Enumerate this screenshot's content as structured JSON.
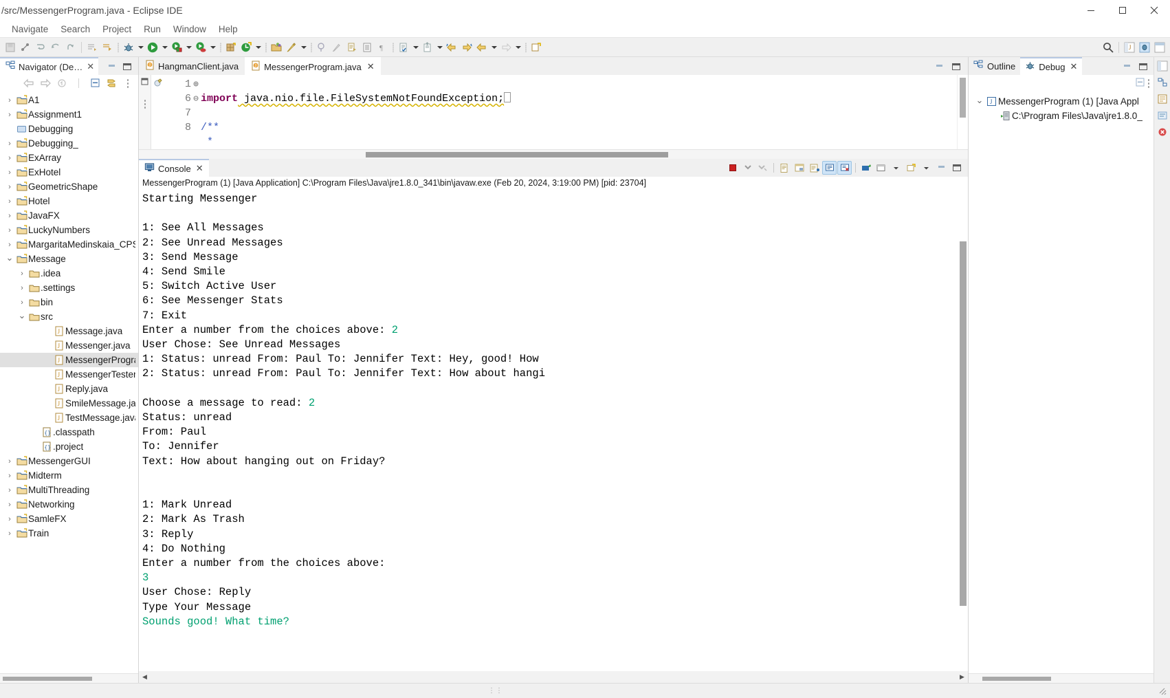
{
  "window": {
    "title": "/src/MessengerProgram.java - Eclipse IDE",
    "minimize_label": "─",
    "maximize_label": "❐",
    "close_label": "✕"
  },
  "menubar": {
    "items": [
      "Navigate",
      "Search",
      "Project",
      "Run",
      "Window",
      "Help"
    ]
  },
  "navigator": {
    "tab_label": "Navigator (De…",
    "tab_close": "✕",
    "toolbar": [
      "back-icon",
      "forward-icon",
      "up-icon",
      "collapse-all-icon",
      "link-with-editor-icon",
      "view-menu-icon"
    ],
    "items": [
      {
        "label": "A1",
        "indent": 0,
        "twisty": "›",
        "icon": "project-folder"
      },
      {
        "label": "Assignment1",
        "indent": 0,
        "twisty": "›",
        "icon": "project-folder"
      },
      {
        "label": "Debugging",
        "indent": 0,
        "twisty": "",
        "icon": "closed-project"
      },
      {
        "label": "Debugging_",
        "indent": 0,
        "twisty": "›",
        "icon": "project-folder"
      },
      {
        "label": "ExArray",
        "indent": 0,
        "twisty": "›",
        "icon": "project-folder"
      },
      {
        "label": "ExHotel",
        "indent": 0,
        "twisty": "›",
        "icon": "project-folder"
      },
      {
        "label": "GeometricShape",
        "indent": 0,
        "twisty": "›",
        "icon": "project-folder"
      },
      {
        "label": "Hotel",
        "indent": 0,
        "twisty": "›",
        "icon": "project-folder"
      },
      {
        "label": "JavaFX",
        "indent": 0,
        "twisty": "›",
        "icon": "project-folder"
      },
      {
        "label": "LuckyNumbers",
        "indent": 0,
        "twisty": "›",
        "icon": "project-folder"
      },
      {
        "label": "MargaritaMedinskaia_CPS",
        "indent": 0,
        "twisty": "›",
        "icon": "project-folder"
      },
      {
        "label": "Message",
        "indent": 0,
        "twisty": "⌄",
        "icon": "project-folder"
      },
      {
        "label": ".idea",
        "indent": 1,
        "twisty": "›",
        "icon": "folder"
      },
      {
        "label": ".settings",
        "indent": 1,
        "twisty": "›",
        "icon": "folder"
      },
      {
        "label": "bin",
        "indent": 1,
        "twisty": "›",
        "icon": "folder"
      },
      {
        "label": "src",
        "indent": 1,
        "twisty": "⌄",
        "icon": "folder"
      },
      {
        "label": "Message.java",
        "indent": 3,
        "twisty": "",
        "icon": "java-file"
      },
      {
        "label": "Messenger.java",
        "indent": 3,
        "twisty": "",
        "icon": "java-file"
      },
      {
        "label": "MessengerProgram.",
        "indent": 3,
        "twisty": "",
        "icon": "java-file",
        "selected": true
      },
      {
        "label": "MessengerTester.jav",
        "indent": 3,
        "twisty": "",
        "icon": "java-file"
      },
      {
        "label": "Reply.java",
        "indent": 3,
        "twisty": "",
        "icon": "java-file"
      },
      {
        "label": "SmileMessage.java",
        "indent": 3,
        "twisty": "",
        "icon": "java-file"
      },
      {
        "label": "TestMessage.java",
        "indent": 3,
        "twisty": "",
        "icon": "java-file"
      },
      {
        "label": ".classpath",
        "indent": 2,
        "twisty": "",
        "icon": "config-file"
      },
      {
        "label": ".project",
        "indent": 2,
        "twisty": "",
        "icon": "config-file"
      },
      {
        "label": "MessengerGUI",
        "indent": 0,
        "twisty": "›",
        "icon": "project-folder"
      },
      {
        "label": "Midterm",
        "indent": 0,
        "twisty": "›",
        "icon": "project-folder"
      },
      {
        "label": "MultiThreading",
        "indent": 0,
        "twisty": "›",
        "icon": "project-folder"
      },
      {
        "label": "Networking",
        "indent": 0,
        "twisty": "›",
        "icon": "project-folder"
      },
      {
        "label": "SamleFX",
        "indent": 0,
        "twisty": "›",
        "icon": "project-folder"
      },
      {
        "label": "Train",
        "indent": 0,
        "twisty": "›",
        "icon": "project-folder"
      }
    ]
  },
  "editor": {
    "tabs": [
      {
        "label": "HangmanClient.java",
        "active": false,
        "close": ""
      },
      {
        "label": "MessengerProgram.java",
        "active": true,
        "close": "✕"
      }
    ],
    "lines": [
      {
        "number": "1",
        "fold": "⊕",
        "text": "import java.nio.file.FileSystemNotFoundException;"
      },
      {
        "number": "6",
        "fold": "",
        "text": ""
      },
      {
        "number": "7",
        "fold": "⊖",
        "text": "/**"
      },
      {
        "number": "8",
        "fold": "",
        "text": " *"
      }
    ],
    "code_keyword": "import",
    "code_rest": " java.nio.file.FileSystemNotFoundException;",
    "comment_open": "/**",
    "comment_star": " *"
  },
  "console": {
    "tab_label": "Console",
    "tab_close": "✕",
    "status_line": "MessengerProgram (1) [Java Application] C:\\Program Files\\Java\\jre1.8.0_341\\bin\\javaw.exe  (Feb 20, 2024, 3:19:00 PM) [pid: 23704]",
    "toolbar": [
      "terminate-icon",
      "remove-launch-icon",
      "remove-all-terminated-icon",
      "open-console-icon",
      "open-console-2-icon",
      "display-selected-console-icon",
      "scroll-lock-icon",
      "clear-console-icon",
      "pin-console-icon",
      "new-console-view-icon",
      "console-menu-icon",
      "open-console-dropdown-icon"
    ],
    "output": [
      {
        "t": "Starting Messenger",
        "c": "out"
      },
      {
        "t": "",
        "c": "out"
      },
      {
        "t": "1: See All Messages",
        "c": "out"
      },
      {
        "t": "2: See Unread Messages",
        "c": "out"
      },
      {
        "t": "3: Send Message",
        "c": "out"
      },
      {
        "t": "4: Send Smile",
        "c": "out"
      },
      {
        "t": "5: Switch Active User",
        "c": "out"
      },
      {
        "t": "6: See Messenger Stats",
        "c": "out"
      },
      {
        "t": "7: Exit",
        "c": "out"
      },
      {
        "t": "Enter a number from the choices above: ",
        "c": "out",
        "in": "2"
      },
      {
        "t": "User Chose: See Unread Messages",
        "c": "out"
      },
      {
        "t": "1: Status: unread From: Paul To: Jennifer Text: Hey, good! How",
        "c": "out"
      },
      {
        "t": "2: Status: unread From: Paul To: Jennifer Text: How about hangi",
        "c": "out"
      },
      {
        "t": "",
        "c": "out"
      },
      {
        "t": "Choose a message to read: ",
        "c": "out",
        "in": "2"
      },
      {
        "t": "Status: unread",
        "c": "out"
      },
      {
        "t": "From: Paul",
        "c": "out"
      },
      {
        "t": "To: Jennifer",
        "c": "out"
      },
      {
        "t": "Text: How about hanging out on Friday?",
        "c": "out"
      },
      {
        "t": "",
        "c": "out"
      },
      {
        "t": "",
        "c": "out"
      },
      {
        "t": "1: Mark Unread",
        "c": "out"
      },
      {
        "t": "2: Mark As Trash",
        "c": "out"
      },
      {
        "t": "3: Reply",
        "c": "out"
      },
      {
        "t": "4: Do Nothing",
        "c": "out"
      },
      {
        "t": "Enter a number from the choices above:",
        "c": "out"
      },
      {
        "t": "3",
        "c": "in"
      },
      {
        "t": "User Chose: Reply",
        "c": "out"
      },
      {
        "t": "Type Your Message",
        "c": "out"
      },
      {
        "t": "Sounds good! What time?",
        "c": "in"
      }
    ],
    "scroll_left_arrow": "◀",
    "scroll_right_arrow": "▶"
  },
  "right_panel": {
    "tabs": [
      {
        "label": "Outline",
        "active": false,
        "close": ""
      },
      {
        "label": "Debug",
        "active": true,
        "close": "✕"
      }
    ],
    "tree": [
      {
        "label": "MessengerProgram (1) [Java Appl",
        "indent": 0,
        "twisty": "⌄",
        "icon": "java-launch"
      },
      {
        "label": "C:\\Program Files\\Java\\jre1.8.0_",
        "indent": 1,
        "twisty": "",
        "icon": "jvm-thread"
      }
    ]
  },
  "colors": {
    "accent_tab": "#b7c9e3",
    "console_input": "#00a070",
    "keyword": "#7f0055",
    "comment": "#3f5fbf",
    "selection": "#e0e0e0"
  }
}
